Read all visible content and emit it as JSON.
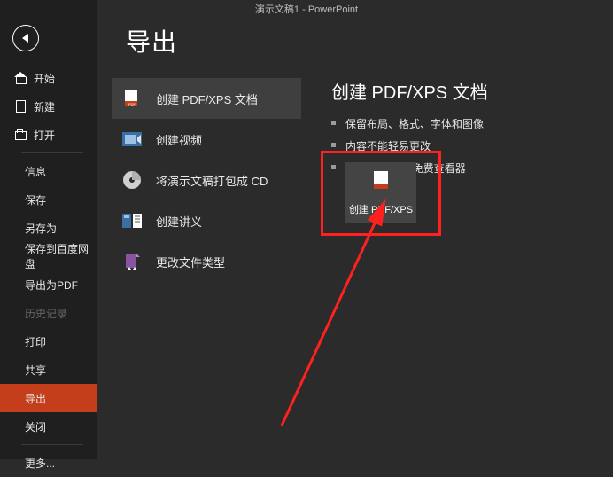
{
  "titlebar": "演示文稿1  -  PowerPoint",
  "sidebar": {
    "back": "返回",
    "items": [
      {
        "label": "开始",
        "icon": "home-icon"
      },
      {
        "label": "新建",
        "icon": "new-icon"
      },
      {
        "label": "打开",
        "icon": "open-icon"
      }
    ],
    "section": [
      {
        "label": "信息"
      },
      {
        "label": "保存"
      },
      {
        "label": "另存为"
      },
      {
        "label": "保存到百度网盘"
      },
      {
        "label": "导出为PDF"
      },
      {
        "label": "历史记录",
        "disabled": true
      },
      {
        "label": "打印"
      },
      {
        "label": "共享"
      },
      {
        "label": "导出",
        "active": true
      },
      {
        "label": "关闭"
      },
      {
        "label": "更多..."
      }
    ]
  },
  "page": {
    "title": "导出",
    "options": [
      {
        "label": "创建 PDF/XPS 文档",
        "icon": "pdf-icon",
        "selected": true
      },
      {
        "label": "创建视频",
        "icon": "video-icon"
      },
      {
        "label": "将演示文稿打包成 CD",
        "icon": "cd-icon"
      },
      {
        "label": "创建讲义",
        "icon": "handout-icon"
      },
      {
        "label": "更改文件类型",
        "icon": "filetype-icon"
      }
    ],
    "pane": {
      "title": "创建 PDF/XPS 文档",
      "bullets": [
        "保留布局、格式、字体和图像",
        "内容不能轻易更改",
        "Web 上提供了免费查看器"
      ],
      "button": "创建 PDF/XPS"
    }
  }
}
